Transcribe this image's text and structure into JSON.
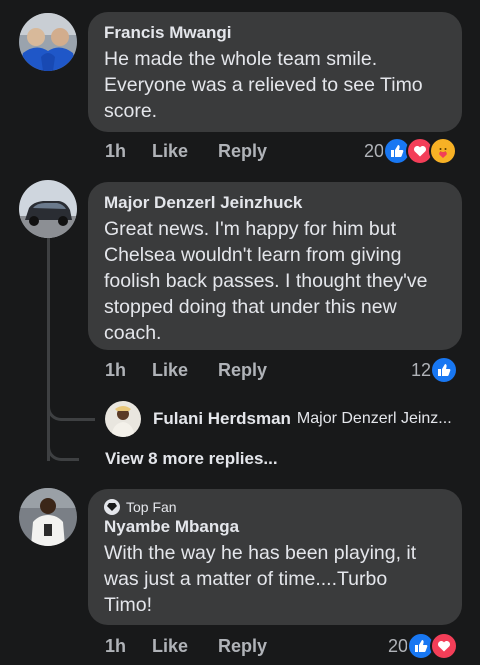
{
  "comments": [
    {
      "author": "Francis Mwangi",
      "text": "He made the whole team smile. Everyone was a relieved to see Timo score.",
      "lines": [
        "He made the whole team smile.",
        "Everyone was a relieved to see Timo",
        "score."
      ],
      "time": "1h",
      "like_label": "Like",
      "reply_label": "Reply",
      "reaction_count": "20",
      "reactions": [
        "like-icon",
        "love-icon",
        "care-icon"
      ]
    },
    {
      "author": "Major Denzerl Jeinzhuck",
      "text": "Great news. I'm happy for him but Chelsea wouldn't learn from giving foolish back passes. I thought they've stopped doing that under this new coach.",
      "lines": [
        "Great news. I'm happy for him but",
        "Chelsea wouldn't learn from giving",
        "foolish back passes. I thought they've",
        "stopped doing that under this new",
        "coach."
      ],
      "time": "1h",
      "like_label": "Like",
      "reply_label": "Reply",
      "reaction_count": "12",
      "reactions": [
        "like-icon"
      ],
      "reply_preview": {
        "author": "Fulani Herdsman",
        "snippet": "Major Denzerl Jeinz..."
      },
      "view_more": "View 8 more replies..."
    },
    {
      "badge": "Top Fan",
      "author": "Nyambe Mbanga",
      "text": "With the way he has been playing, it was just a matter of time....Turbo Timo!",
      "lines": [
        "With the way he has been playing, it",
        "was just a matter of time....Turbo",
        "Timo!"
      ],
      "time": "1h",
      "like_label": "Like",
      "reply_label": "Reply",
      "reaction_count": "20",
      "reactions": [
        "like-icon",
        "love-icon"
      ]
    }
  ],
  "colors": {
    "background": "#18191a",
    "bubble": "#3a3b3c",
    "like_blue": "#1877f2",
    "love_red": "#f33e58",
    "care_yellow": "#f7b125"
  }
}
